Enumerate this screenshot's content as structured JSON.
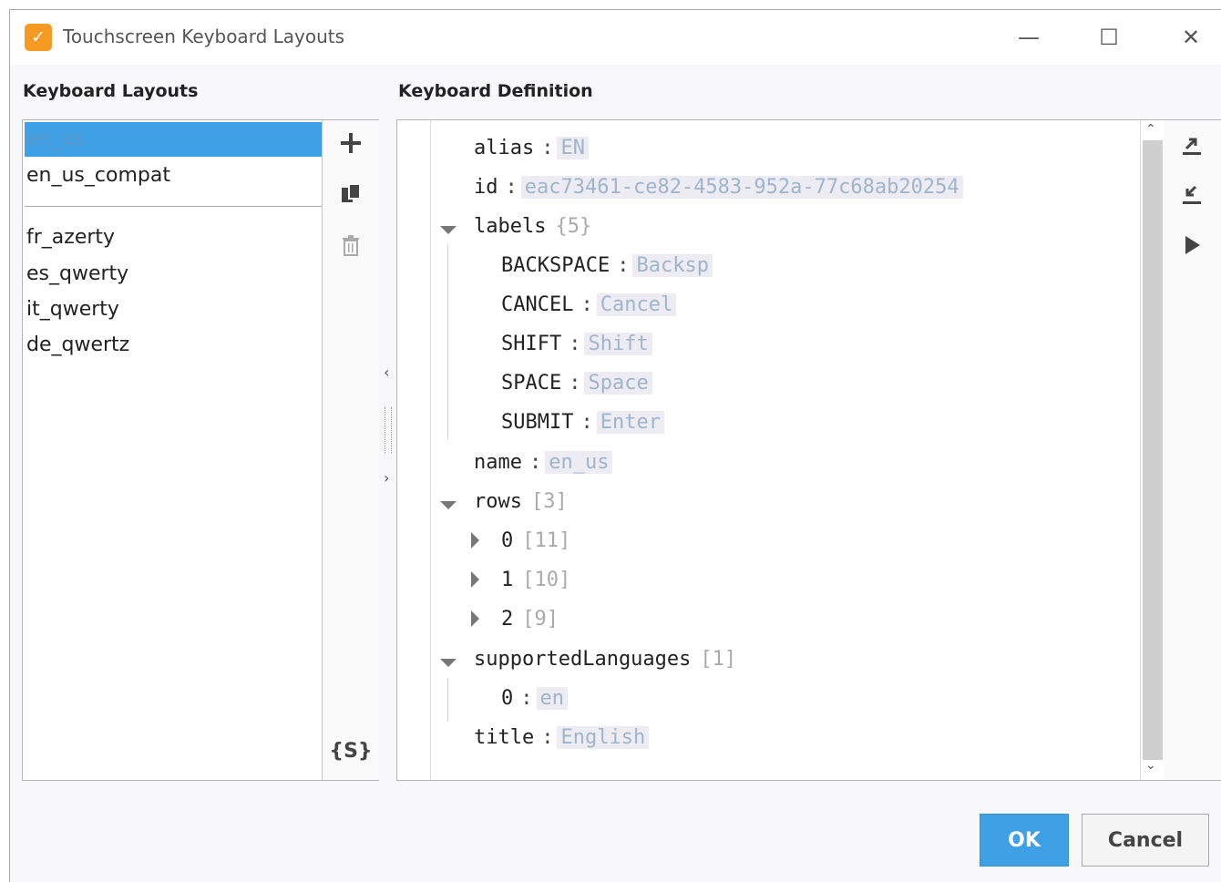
{
  "window": {
    "title": "Touchscreen Keyboard Layouts",
    "accent_color": "#3fa0e6",
    "controls": {
      "minimize": "—",
      "maximize": "☐",
      "close": "✕"
    }
  },
  "layouts": {
    "heading": "Keyboard Layouts",
    "items": [
      "en_us",
      "en_us_compat",
      "fr_azerty",
      "es_qwerty",
      "it_qwerty",
      "de_qwertz"
    ],
    "selected": "en_us",
    "toolbar": {
      "add_icon": "plus-icon",
      "duplicate_icon": "copy-icon",
      "delete_icon": "trash-icon",
      "script_label": "{S}"
    }
  },
  "definition": {
    "heading": "Keyboard Definition",
    "tree": {
      "alias_key": "alias",
      "alias_value": "EN",
      "id_key": "id",
      "id_value": "eac73461-ce82-4583-952a-77c68ab20254",
      "labels_key": "labels",
      "labels_count": "{5}",
      "labels": [
        {
          "key": "BACKSPACE",
          "value": "Backsp"
        },
        {
          "key": "CANCEL",
          "value": "Cancel"
        },
        {
          "key": "SHIFT",
          "value": "Shift"
        },
        {
          "key": "SPACE",
          "value": "Space"
        },
        {
          "key": "SUBMIT",
          "value": "Enter"
        }
      ],
      "name_key": "name",
      "name_value": "en_us",
      "rows_key": "rows",
      "rows_count": "[3]",
      "rows": [
        {
          "key": "0",
          "count": "[11]"
        },
        {
          "key": "1",
          "count": "[10]"
        },
        {
          "key": "2",
          "count": "[9]"
        }
      ],
      "langs_key": "supportedLanguages",
      "langs_count": "[1]",
      "langs": [
        {
          "key": "0",
          "value": "en"
        }
      ],
      "title_key": "title",
      "title_value": "English"
    },
    "side_toolbar": {
      "export_icon": "export-icon",
      "import_icon": "import-icon",
      "preview_icon": "play-icon"
    }
  },
  "buttons": {
    "ok": "OK",
    "cancel": "Cancel"
  }
}
